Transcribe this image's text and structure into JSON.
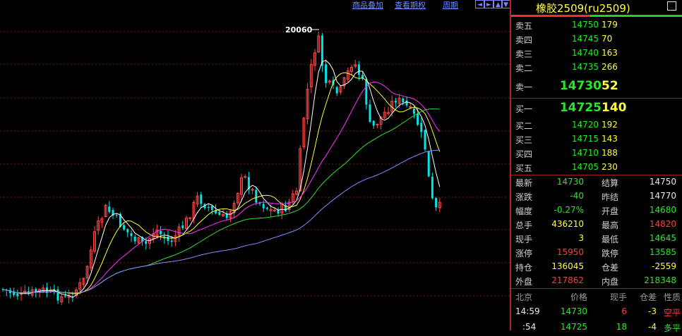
{
  "toolbar": {
    "overlay": "商品叠加",
    "rights": "查看期权",
    "period": "周期",
    "arrow_buttons": [
      "◄",
      "►",
      "▲",
      "▼"
    ]
  },
  "chart": {
    "annotation_high": "20060",
    "colors": {
      "up": "#ff4444",
      "down": "#00e5e5",
      "ma5": "#ffffff",
      "ma10": "#ffff33",
      "ma20": "#ff33ff",
      "ma40": "#33dd33",
      "ma60": "#8888ff",
      "grid": "#7a1a1a"
    }
  },
  "quote": {
    "title": "橡胶2509(ru2509)",
    "asks": [
      {
        "label": "卖五",
        "price": "14750",
        "vol": "179"
      },
      {
        "label": "卖四",
        "price": "14745",
        "vol": "70"
      },
      {
        "label": "卖三",
        "price": "14740",
        "vol": "163"
      },
      {
        "label": "卖二",
        "price": "14735",
        "vol": "266"
      },
      {
        "label": "卖一",
        "price": "14730",
        "vol": "52"
      }
    ],
    "bids": [
      {
        "label": "买一",
        "price": "14725",
        "vol": "140"
      },
      {
        "label": "买二",
        "price": "14720",
        "vol": "192"
      },
      {
        "label": "买三",
        "price": "14715",
        "vol": "143"
      },
      {
        "label": "买四",
        "price": "14710",
        "vol": "188"
      },
      {
        "label": "买五",
        "price": "14705",
        "vol": "230"
      }
    ],
    "stats": [
      {
        "l1": "最新",
        "v1": "14730",
        "c1": "g",
        "l2": "结算",
        "v2": "14750",
        "c2": "w"
      },
      {
        "l1": "涨跌",
        "v1": "-40",
        "c1": "g",
        "l2": "昨结",
        "v2": "14770",
        "c2": "w"
      },
      {
        "l1": "幅度",
        "v1": "-0.27%",
        "c1": "g",
        "l2": "开盘",
        "v2": "14680",
        "c2": "g"
      },
      {
        "l1": "总手",
        "v1": "436210",
        "c1": "y",
        "l2": "最高",
        "v2": "14820",
        "c2": "r"
      },
      {
        "l1": "现手",
        "v1": "3",
        "c1": "y",
        "l2": "最低",
        "v2": "14645",
        "c2": "g"
      },
      {
        "l1": "涨停",
        "v1": "15950",
        "c1": "r",
        "l2": "跌停",
        "v2": "13585",
        "c2": "g"
      },
      {
        "l1": "持仓",
        "v1": "136045",
        "c1": "y",
        "l2": "仓差",
        "v2": "-2559",
        "c2": "y"
      },
      {
        "l1": "外盘",
        "v1": "217862",
        "c1": "r",
        "l2": "内盘",
        "v2": "218348",
        "c2": "g"
      }
    ],
    "ticks_header": {
      "time": "北京",
      "price": "价格",
      "vol": "现手",
      "oi": "仓差",
      "nature": "性质"
    },
    "ticks": [
      {
        "time": "14:59",
        "price": "14730",
        "vol": "6",
        "oi": "-3",
        "nature": "空平"
      },
      {
        "time": ":54",
        "price": "14725",
        "vol": "18",
        "oi": "-4",
        "nature": "多平"
      }
    ]
  }
}
